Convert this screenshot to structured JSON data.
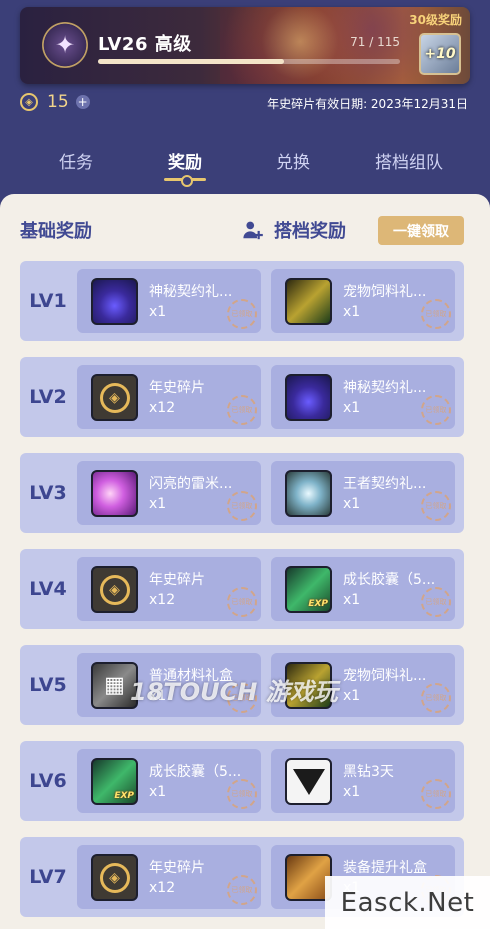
{
  "banner": {
    "title": "LV26 高级",
    "progress_text": "71 / 115",
    "progress_fraction": 0.617,
    "bonus_label": "30级奖励",
    "bonus_item_text": "+10"
  },
  "shards": {
    "count": "15",
    "plus": "+",
    "expiry": "年史碎片有效日期: 2023年12月31日"
  },
  "tabs": [
    {
      "label": "任务",
      "active": false
    },
    {
      "label": "奖励",
      "active": true
    },
    {
      "label": "兑换",
      "active": false
    },
    {
      "label": "搭档组队",
      "active": false
    }
  ],
  "panel": {
    "basic_title": "基础奖励",
    "partner_title": "搭档奖励",
    "claim_all": "一键领取",
    "stamp_text": "已领取"
  },
  "rows": [
    {
      "level": "LV1",
      "left": {
        "name": "神秘契约礼...",
        "qty": "x1",
        "icon": "mystery-bag-icon"
      },
      "right": {
        "name": "宠物饲料礼...",
        "qty": "x1",
        "icon": "pet-feed-icon"
      }
    },
    {
      "level": "LV2",
      "left": {
        "name": "年史碎片",
        "qty": "x12",
        "icon": "chronicle-shard-icon"
      },
      "right": {
        "name": "神秘契约礼...",
        "qty": "x1",
        "icon": "mystery-bag-icon"
      }
    },
    {
      "level": "LV3",
      "left": {
        "name": "闪亮的雷米...",
        "qty": "x1",
        "icon": "shiny-orb-icon"
      },
      "right": {
        "name": "王者契约礼...",
        "qty": "x1",
        "icon": "king-contract-icon"
      }
    },
    {
      "level": "LV4",
      "left": {
        "name": "年史碎片",
        "qty": "x12",
        "icon": "chronicle-shard-icon"
      },
      "right": {
        "name": "成长胶囊（5...",
        "qty": "x1",
        "icon": "growth-capsule-icon"
      }
    },
    {
      "level": "LV5",
      "left": {
        "name": "普通材料礼盒",
        "qty": "x1",
        "icon": "material-box-icon"
      },
      "right": {
        "name": "宠物饲料礼...",
        "qty": "x1",
        "icon": "pet-feed-icon"
      }
    },
    {
      "level": "LV6",
      "left": {
        "name": "成长胶囊（5...",
        "qty": "x1",
        "icon": "growth-capsule-icon"
      },
      "right": {
        "name": "黑钻3天",
        "qty": "x1",
        "icon": "black-diamond-icon"
      }
    },
    {
      "level": "LV7",
      "left": {
        "name": "年史碎片",
        "qty": "x12",
        "icon": "chronicle-shard-icon"
      },
      "right": {
        "name": "装备提升礼盒",
        "qty": "x1",
        "icon": "equip-box-icon"
      }
    }
  ],
  "watermarks": {
    "corner": "Easck.Net",
    "center": "18TOUCH 游戏玩"
  }
}
